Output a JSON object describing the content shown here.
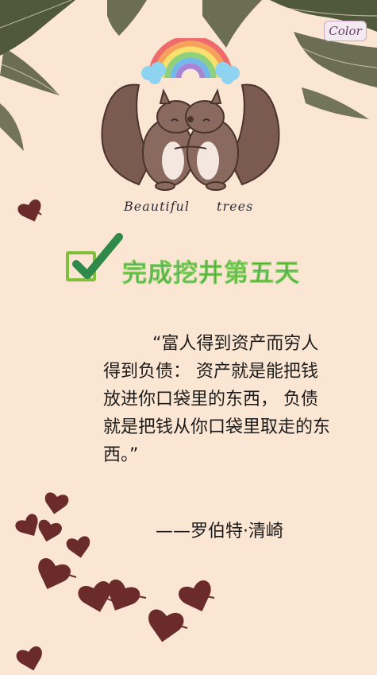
{
  "brand": {
    "logo_text": "Color",
    "logo_icon": "color-logo-badge"
  },
  "illustration": {
    "caption": "Beautiful trees",
    "subject": "two-squirrels-hugging-icon",
    "rainbow": "rainbow-icon",
    "leaves": "palm-leaf-icon",
    "petals": "heart-petal-icon"
  },
  "task": {
    "checkbox_state": "checked",
    "title": "完成挖井第五天"
  },
  "quote": {
    "text": "“富人得到资产而穷人得到负债： 资产就是能把钱放进你口袋里的东西， 负债就是把钱从你口袋里取走的东西。”",
    "author": "——罗伯特·清崎"
  },
  "colors": {
    "background": "#fbe6d3",
    "leaf": "#3f4a2c",
    "petal": "#6b2b2b",
    "squirrel": "#7b5a4f",
    "title_green": "#2f8a4a",
    "check_green": "#7fbf3a"
  }
}
